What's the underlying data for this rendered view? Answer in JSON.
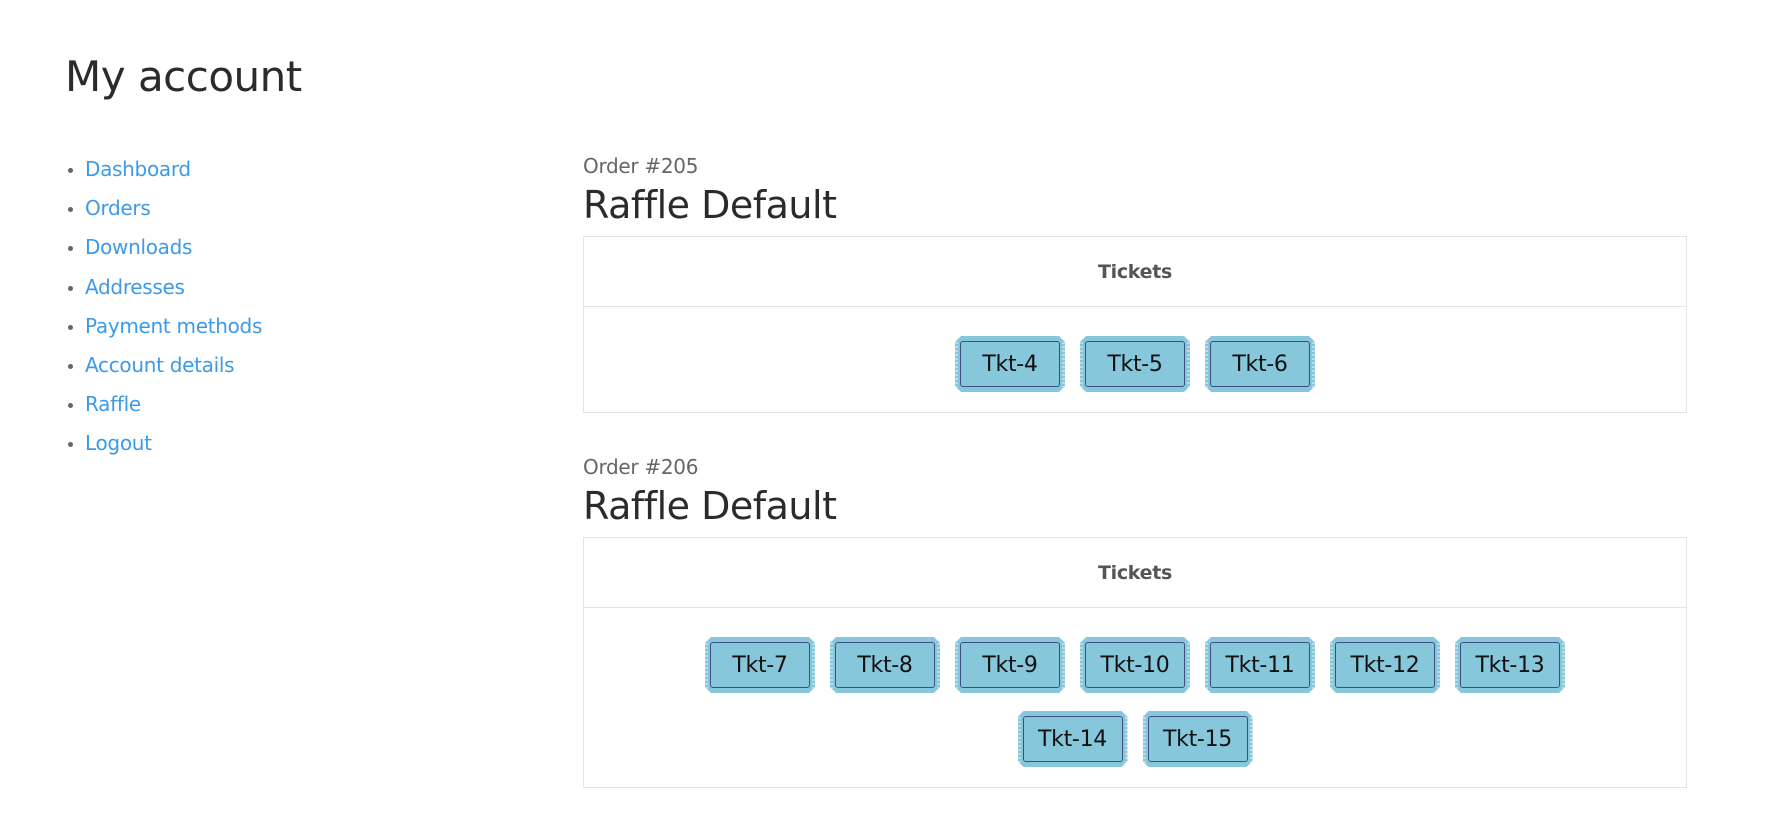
{
  "page": {
    "title": "My account"
  },
  "nav": {
    "items": [
      {
        "label": "Dashboard"
      },
      {
        "label": "Orders"
      },
      {
        "label": "Downloads"
      },
      {
        "label": "Addresses"
      },
      {
        "label": "Payment methods"
      },
      {
        "label": "Account details"
      },
      {
        "label": "Raffle"
      },
      {
        "label": "Logout"
      }
    ]
  },
  "orders": [
    {
      "order_label": "Order #205",
      "raffle_name": "Raffle Default",
      "table_header": "Tickets",
      "tickets": [
        "Tkt-4",
        "Tkt-5",
        "Tkt-6"
      ]
    },
    {
      "order_label": "Order #206",
      "raffle_name": "Raffle Default",
      "table_header": "Tickets",
      "tickets": [
        "Tkt-7",
        "Tkt-8",
        "Tkt-9",
        "Tkt-10",
        "Tkt-11",
        "Tkt-12",
        "Tkt-13",
        "Tkt-14",
        "Tkt-15"
      ]
    }
  ],
  "colors": {
    "link": "#3d9ae8",
    "ticket_fill": "#87c7dc",
    "ticket_border": "#3f4f82"
  }
}
